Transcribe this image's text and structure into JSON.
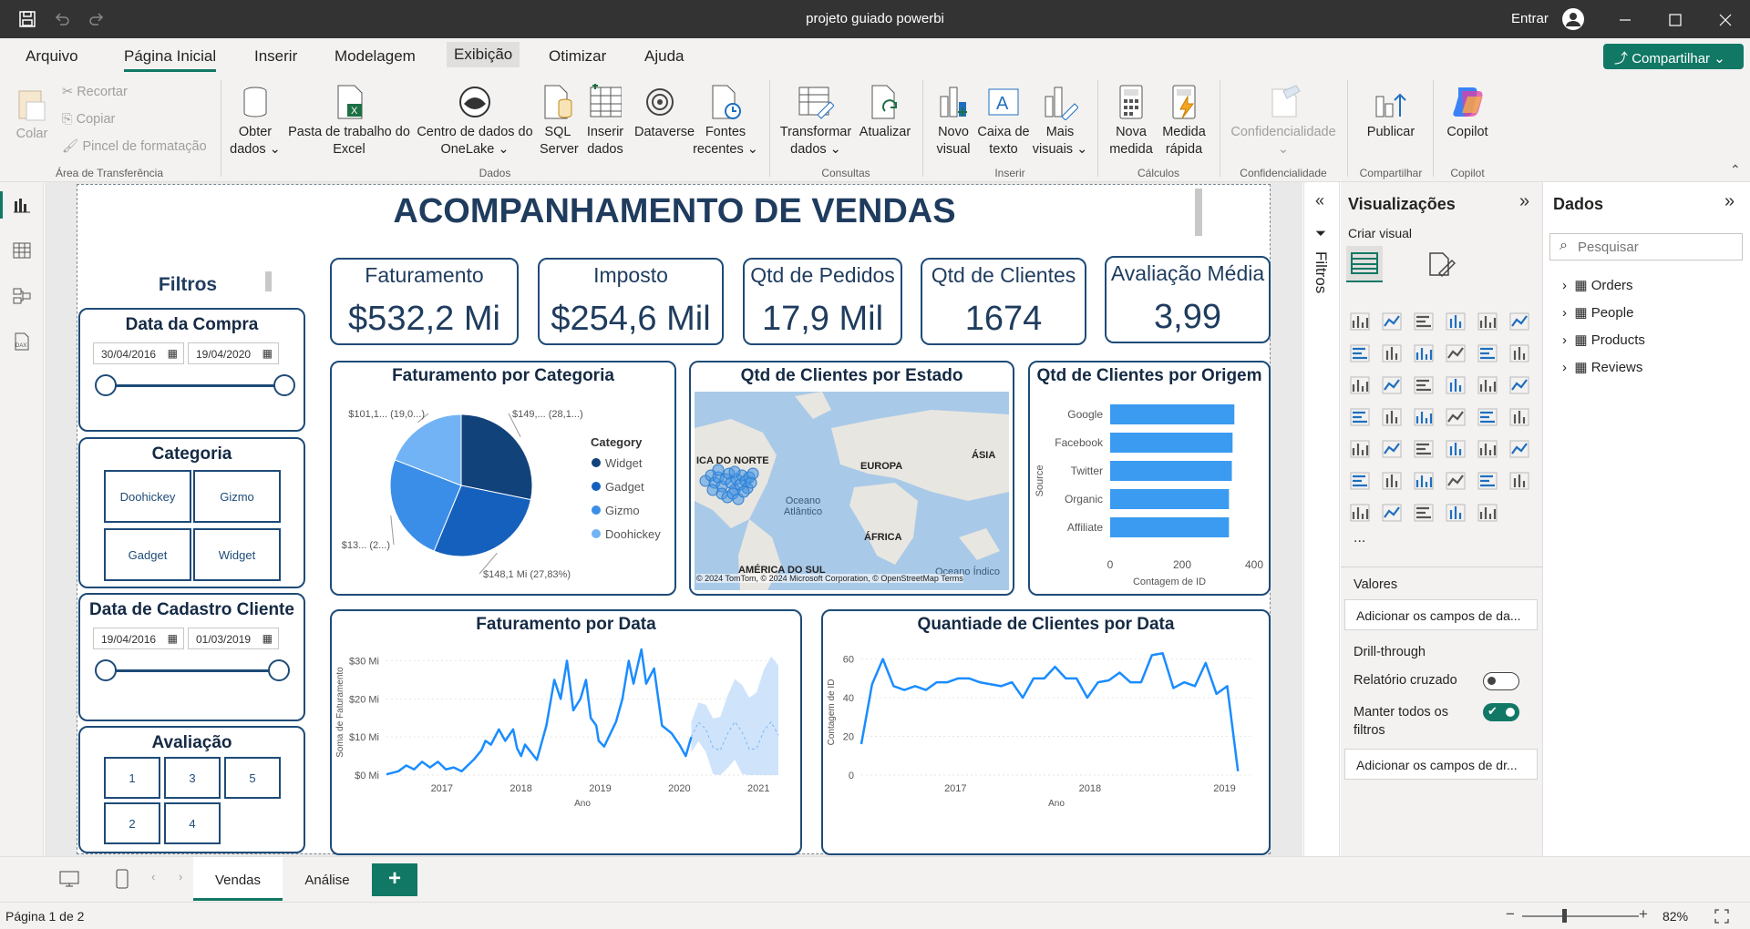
{
  "app": {
    "title": "projeto guiado powerbi",
    "signin": "Entrar"
  },
  "menu": {
    "tabs": [
      "Arquivo",
      "Página Inicial",
      "Inserir",
      "Modelagem",
      "Exibição",
      "Otimizar",
      "Ajuda"
    ],
    "share": "Compartilhar"
  },
  "ribbon": {
    "clipboard": {
      "paste": "Colar",
      "cut": "Recortar",
      "copy": "Copiar",
      "format_painter": "Pincel de formatação",
      "group": "Área de Transferência"
    },
    "data": {
      "get_data": "Obter dados",
      "excel": "Pasta de trabalho do Excel",
      "onelake": "Centro de dados do OneLake",
      "sql": "SQL Server",
      "enter_data": "Inserir dados",
      "dataverse": "Dataverse",
      "recent": "Fontes recentes",
      "group": "Dados"
    },
    "queries": {
      "transform": "Transformar dados",
      "refresh": "Atualizar",
      "group": "Consultas"
    },
    "insert": {
      "new_visual": "Novo visual",
      "text_box": "Caixa de texto",
      "more_visuals": "Mais visuais",
      "group": "Inserir"
    },
    "calc": {
      "new_measure": "Nova medida",
      "quick_measure": "Medida rápida",
      "group": "Cálculos"
    },
    "sensitivity": {
      "label": "Confidencialidade",
      "group": "Confidencialidade"
    },
    "share": {
      "publish": "Publicar",
      "group": "Compartilhar"
    },
    "copilot": {
      "label": "Copilot",
      "group": "Copilot"
    }
  },
  "report": {
    "title": "ACOMPANHAMENTO DE VENDAS",
    "filters_label": "Filtros",
    "kpis": [
      {
        "label": "Faturamento",
        "value": "$532,2 Mi"
      },
      {
        "label": "Imposto",
        "value": "$254,6 Mil"
      },
      {
        "label": "Qtd de Pedidos",
        "value": "17,9 Mil"
      },
      {
        "label": "Qtd de Clientes",
        "value": "1674"
      },
      {
        "label": "Avaliação Média",
        "value": "3,99"
      }
    ],
    "slicers": {
      "purchase_date": {
        "title": "Data da Compra",
        "from": "30/04/2016",
        "to": "19/04/2020"
      },
      "category": {
        "title": "Categoria",
        "items": [
          "Doohickey",
          "Gizmo",
          "Gadget",
          "Widget"
        ]
      },
      "signup_date": {
        "title": "Data de Cadastro Cliente",
        "from": "19/04/2016",
        "to": "01/03/2019"
      },
      "rating": {
        "title": "Avaliação",
        "items": [
          "1",
          "3",
          "5",
          "2",
          "4"
        ]
      }
    },
    "map": {
      "title": "Qtd de Clientes por Estado",
      "labels": [
        "ICA DO NORTE",
        "EUROPA",
        "ÁSIA",
        "Oceano Atlântico",
        "ÁFRICA",
        "AMÉRICA DO SUL",
        "Oceano Índico"
      ],
      "credit": "© 2024 TomTom, © 2024 Microsoft Corporation, © OpenStreetMap Terms"
    }
  },
  "chart_data": [
    {
      "type": "pie",
      "title": "Faturamento por Categoria",
      "legend_title": "Category",
      "legend_position": "right",
      "categories": [
        "Widget",
        "Gadget",
        "Gizmo",
        "Doohickey"
      ],
      "values": [
        149,
        148.1,
        130,
        101.1
      ],
      "colors": [
        "#12427a",
        "#1560bd",
        "#3b8ee8",
        "#72b3f5"
      ],
      "labels": [
        "$149,... (28,1...)",
        "$148,1 Mi (27,83%)",
        "$13... (2...)",
        "$101,1... (19,0...)"
      ]
    },
    {
      "type": "bar",
      "orientation": "horizontal",
      "title": "Qtd de Clientes por Origem",
      "ylabel": "Source",
      "xlabel": "Contagem de ID",
      "categories": [
        "Google",
        "Facebook",
        "Twitter",
        "Organic",
        "Affiliate"
      ],
      "values": [
        345,
        340,
        338,
        330,
        330
      ],
      "xlim": [
        0,
        400
      ],
      "xticks": [
        "0",
        "200",
        "400"
      ],
      "color": "#3a9bf0"
    },
    {
      "type": "line",
      "title": "Faturamento por Data",
      "xlabel": "Ano",
      "ylabel": "Soma de Faturamento",
      "ylim": [
        0,
        33
      ],
      "yticks": [
        "$0 Mi",
        "$10 Mi",
        "$20 Mi",
        "$30 Mi"
      ],
      "xticks": [
        "2017",
        "2018",
        "2019",
        "2020",
        "2021"
      ],
      "x_range": [
        2016.3,
        2021.25
      ],
      "series": [
        {
          "values": [
            [
              2016.3,
              0.2
            ],
            [
              2016.45,
              1
            ],
            [
              2016.55,
              2.5
            ],
            [
              2016.65,
              1.5
            ],
            [
              2016.75,
              3.5
            ],
            [
              2016.85,
              2
            ],
            [
              2016.95,
              3.5
            ],
            [
              2017.05,
              1.5
            ],
            [
              2017.15,
              2
            ],
            [
              2017.25,
              1
            ],
            [
              2017.4,
              4
            ],
            [
              2017.5,
              6.5
            ],
            [
              2017.55,
              9
            ],
            [
              2017.62,
              8
            ],
            [
              2017.72,
              12
            ],
            [
              2017.8,
              9
            ],
            [
              2017.9,
              12
            ],
            [
              2017.95,
              7
            ],
            [
              2018.0,
              5
            ],
            [
              2018.05,
              8
            ],
            [
              2018.2,
              4
            ],
            [
              2018.32,
              13
            ],
            [
              2018.42,
              25
            ],
            [
              2018.5,
              20
            ],
            [
              2018.58,
              30
            ],
            [
              2018.66,
              17
            ],
            [
              2018.75,
              20
            ],
            [
              2018.82,
              25
            ],
            [
              2018.88,
              15
            ],
            [
              2018.95,
              13
            ],
            [
              2018.98,
              9
            ],
            [
              2019.05,
              7.5
            ],
            [
              2019.2,
              14
            ],
            [
              2019.28,
              20
            ],
            [
              2019.36,
              30
            ],
            [
              2019.42,
              24
            ],
            [
              2019.52,
              33
            ],
            [
              2019.58,
              24
            ],
            [
              2019.68,
              28
            ],
            [
              2019.78,
              13
            ],
            [
              2019.9,
              11
            ],
            [
              2020.0,
              8
            ],
            [
              2020.08,
              5
            ],
            [
              2020.15,
              10
            ]
          ],
          "color": "#1a8cff"
        }
      ],
      "forecast": {
        "from": 2020.15,
        "to": 2021.25,
        "band": true
      }
    },
    {
      "type": "line",
      "title": "Quantiade de Clientes por Data",
      "xlabel": "Ano",
      "ylabel": "Contagem de ID",
      "ylim": [
        0,
        65
      ],
      "yticks": [
        "0",
        "20",
        "40",
        "60"
      ],
      "xticks": [
        "2017",
        "2018",
        "2019"
      ],
      "x_range": [
        2016.3,
        2019.2
      ],
      "series": [
        {
          "values": [
            [
              2016.3,
              16
            ],
            [
              2016.38,
              47
            ],
            [
              2016.46,
              60
            ],
            [
              2016.54,
              46
            ],
            [
              2016.62,
              44
            ],
            [
              2016.7,
              46
            ],
            [
              2016.78,
              44
            ],
            [
              2016.86,
              48
            ],
            [
              2016.94,
              48
            ],
            [
              2017.02,
              50
            ],
            [
              2017.1,
              50
            ],
            [
              2017.18,
              48
            ],
            [
              2017.26,
              47
            ],
            [
              2017.34,
              46
            ],
            [
              2017.42,
              48
            ],
            [
              2017.5,
              40
            ],
            [
              2017.58,
              50
            ],
            [
              2017.66,
              50
            ],
            [
              2017.74,
              56
            ],
            [
              2017.82,
              50
            ],
            [
              2017.9,
              50
            ],
            [
              2017.98,
              40
            ],
            [
              2018.06,
              48
            ],
            [
              2018.14,
              49
            ],
            [
              2018.22,
              53
            ],
            [
              2018.3,
              48
            ],
            [
              2018.38,
              48
            ],
            [
              2018.46,
              62
            ],
            [
              2018.54,
              63
            ],
            [
              2018.62,
              45
            ],
            [
              2018.7,
              48
            ],
            [
              2018.78,
              46
            ],
            [
              2018.86,
              58
            ],
            [
              2018.94,
              42
            ],
            [
              2019.02,
              46
            ],
            [
              2019.1,
              2
            ]
          ],
          "color": "#1a8cff"
        }
      ]
    }
  ],
  "panes": {
    "filters": "Filtros",
    "viz": {
      "title": "Visualizações",
      "create": "Criar visual",
      "values": "Valores",
      "add_fields": "Adicionar os campos de da...",
      "drill": "Drill-through",
      "cross_report": "Relatório cruzado",
      "cross_report_on": false,
      "keep_filters": "Manter todos os filtros",
      "keep_filters_on": true,
      "add_drill": "Adicionar os campos de dr...",
      "more": "..."
    },
    "data": {
      "title": "Dados",
      "search_placeholder": "Pesquisar",
      "tables": [
        "Orders",
        "People",
        "Products",
        "Reviews"
      ]
    }
  },
  "pages": {
    "tabs": [
      "Vendas",
      "Análise"
    ],
    "add": "+"
  },
  "status": {
    "page": "Página 1 de 2",
    "zoom": "82%"
  }
}
